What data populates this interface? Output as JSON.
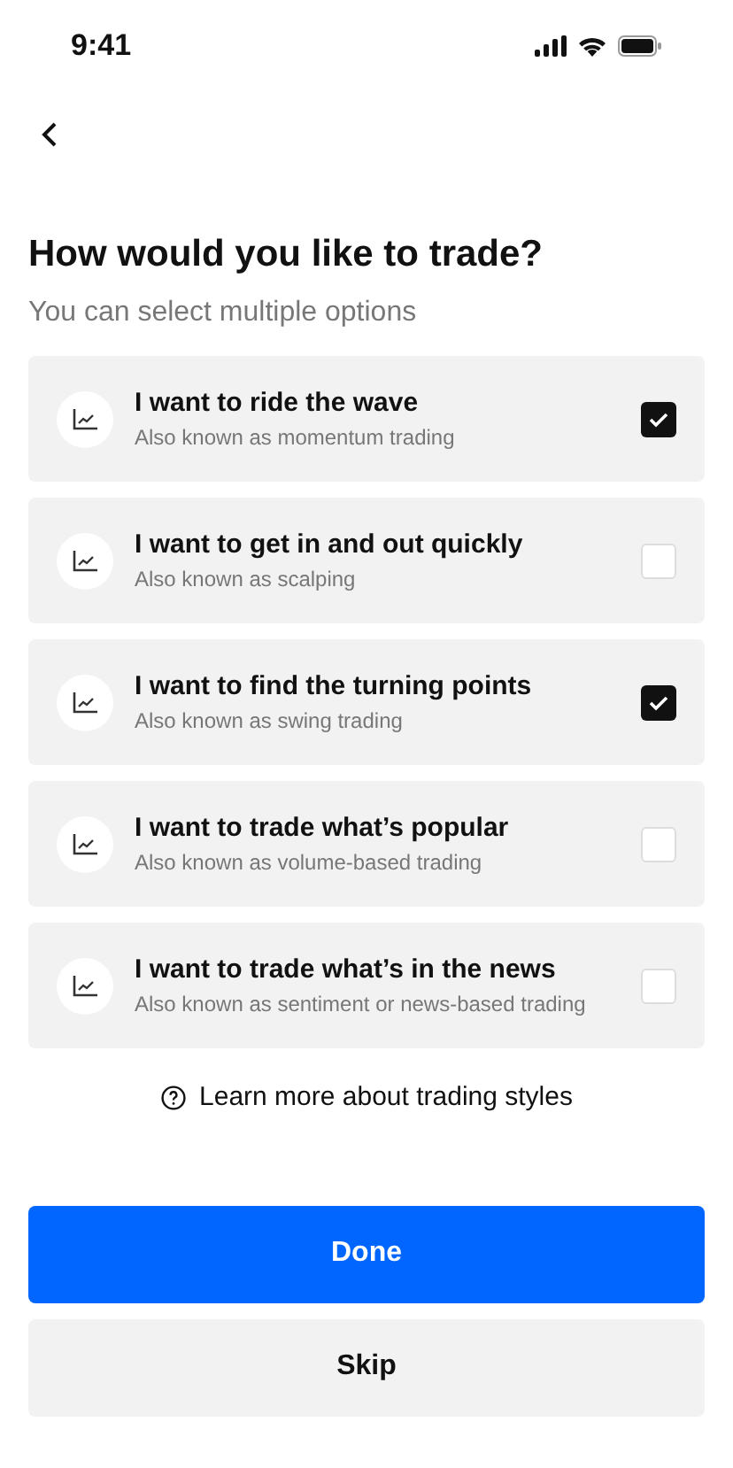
{
  "status_bar": {
    "time": "9:41"
  },
  "title": "How would you like to trade?",
  "subtitle": "You can select multiple options",
  "options": [
    {
      "title": "I want to ride the wave",
      "subtitle": "Also known as momentum trading",
      "checked": true
    },
    {
      "title": "I want to get in and out quickly",
      "subtitle": "Also known as scalping",
      "checked": false
    },
    {
      "title": "I want to find the turning points",
      "subtitle": "Also known as swing trading",
      "checked": true
    },
    {
      "title": "I want to trade what’s popular",
      "subtitle": "Also known as volume-based trading",
      "checked": false
    },
    {
      "title": "I want to trade what’s in the news",
      "subtitle": "Also known as sentiment or news-based trading",
      "checked": false
    }
  ],
  "learn_more": "Learn more about trading styles",
  "buttons": [
    {
      "label": "Done",
      "kind": "primary"
    },
    {
      "label": "Skip",
      "kind": "secondary"
    }
  ]
}
